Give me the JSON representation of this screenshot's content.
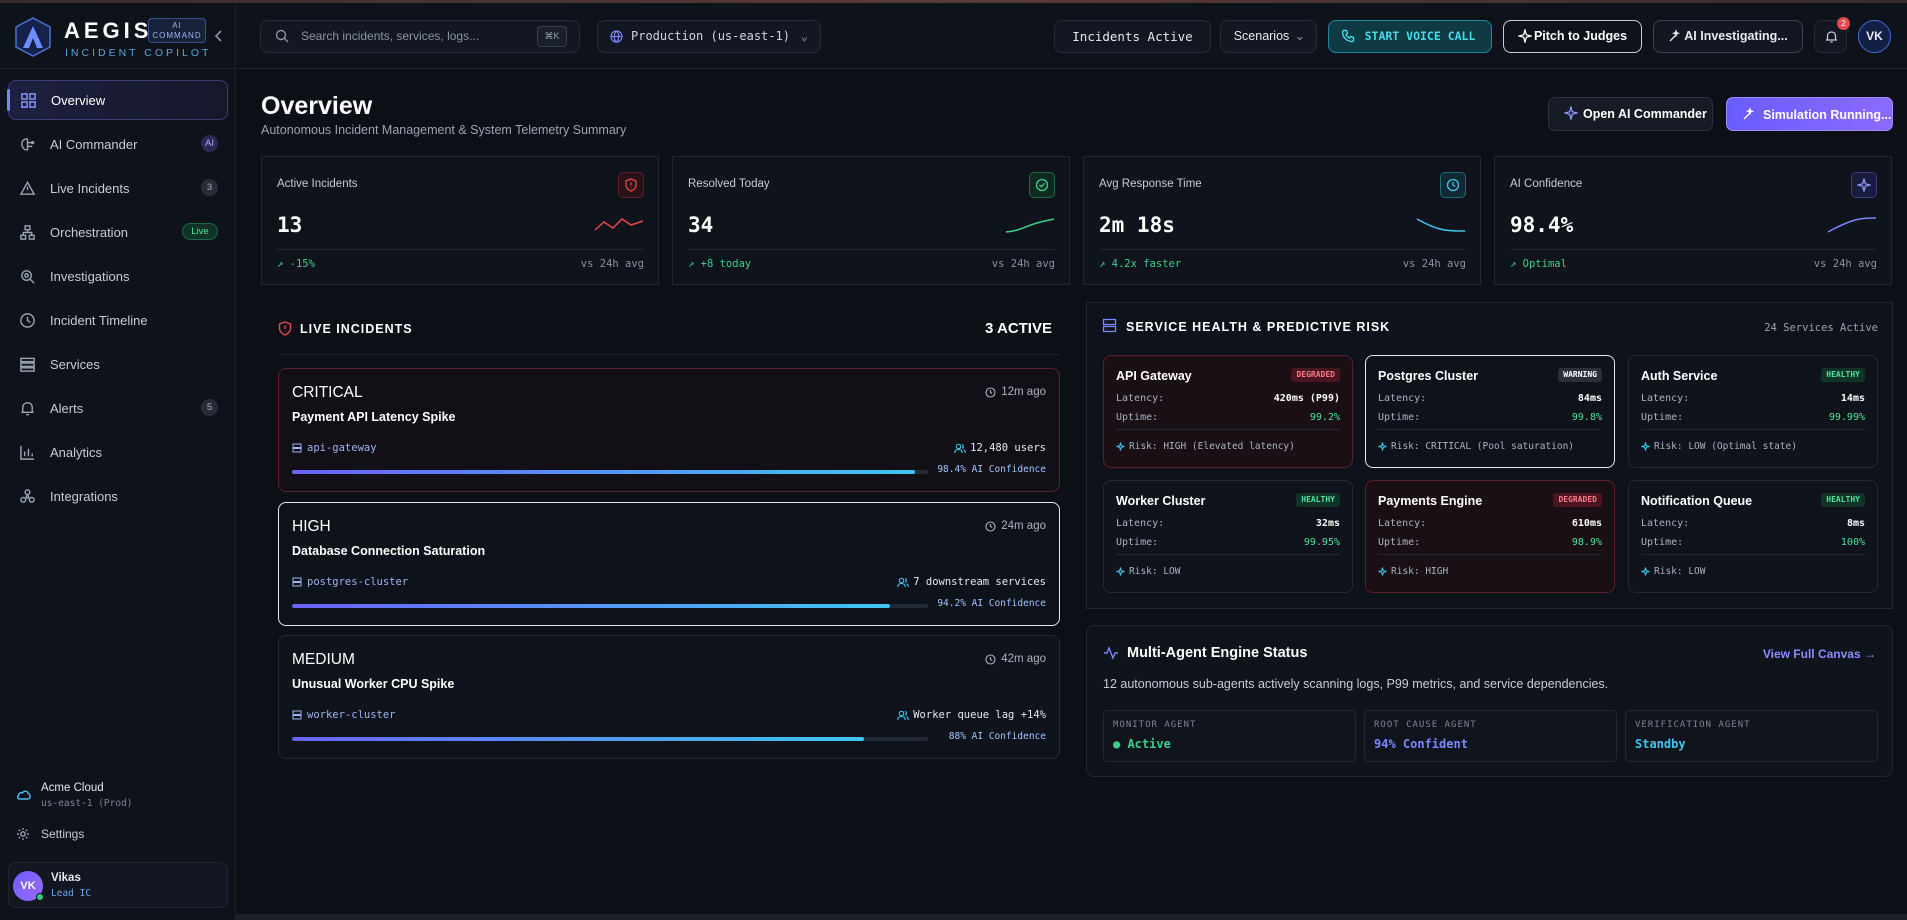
{
  "brand": {
    "name": "AEGIS",
    "badge_line1": "AI",
    "badge_line2": "COMMAND",
    "subtitle": "INCIDENT COPILOT"
  },
  "sidebar": {
    "items": [
      {
        "label": "Overview",
        "icon": "grid-icon",
        "active": true,
        "badge": ""
      },
      {
        "label": "AI Commander",
        "icon": "brain-icon",
        "badge": "AI"
      },
      {
        "label": "Live Incidents",
        "icon": "warning-icon",
        "badge": "3"
      },
      {
        "label": "Orchestration",
        "icon": "network-icon",
        "badge": "Live"
      },
      {
        "label": "Investigations",
        "icon": "search-icon",
        "badge": ""
      },
      {
        "label": "Incident Timeline",
        "icon": "clock-icon",
        "badge": ""
      },
      {
        "label": "Services",
        "icon": "server-icon",
        "badge": ""
      },
      {
        "label": "Alerts",
        "icon": "bell-icon",
        "badge": "5"
      },
      {
        "label": "Analytics",
        "icon": "chart-icon",
        "badge": ""
      },
      {
        "label": "Integrations",
        "icon": "integrations-icon",
        "badge": ""
      }
    ],
    "org": {
      "name": "Acme Cloud",
      "region": "us-east-1 (Prod)"
    },
    "settings": "Settings",
    "user": {
      "initials": "VK",
      "name": "Vikas",
      "role": "Lead IC"
    }
  },
  "topbar": {
    "search_placeholder": "Search incidents, services, logs...",
    "search_kbd": "⌘K",
    "environment": "Production (us-east-1)",
    "incidents_label": "Incidents Active",
    "scenarios_label": "Scenarios",
    "voice_label": "START VOICE CALL",
    "pitch_label": "Pitch to Judges",
    "investigating_label": "AI Investigating...",
    "notifications": "2",
    "avatar": "VK"
  },
  "header": {
    "title": "Overview",
    "subtitle": "Autonomous Incident Management & System Telemetry Summary",
    "open_commander": "Open AI Commander",
    "simulation": "Simulation Running..."
  },
  "kpis": [
    {
      "label": "Active Incidents",
      "value": "13",
      "delta": "-15%",
      "vs": "vs 24h avg",
      "icon": "shield-alert-icon",
      "color": "#e5484d"
    },
    {
      "label": "Resolved Today",
      "value": "34",
      "delta": "+8 today",
      "vs": "vs 24h avg",
      "icon": "check-circle-icon",
      "color": "#3ccf8e"
    },
    {
      "label": "Avg Response Time",
      "value": "2m 18s",
      "delta": "4.2x faster",
      "vs": "vs 24h avg",
      "icon": "clock-icon",
      "color": "#3fc6f0"
    },
    {
      "label": "AI Confidence",
      "value": "98.4%",
      "delta": "Optimal",
      "vs": "vs 24h avg",
      "icon": "sparkle-icon",
      "color": "#7b86ff"
    }
  ],
  "live_incidents": {
    "title": "LIVE INCIDENTS",
    "count": "3 ACTIVE",
    "items": [
      {
        "severity": "CRITICAL",
        "time": "12m ago",
        "title": "Payment API Latency Spike",
        "service": "api-gateway",
        "impact": "12,480 users",
        "confidence": "98.4% AI Confidence",
        "progress": 0.98
      },
      {
        "severity": "HIGH",
        "time": "24m ago",
        "title": "Database Connection Saturation",
        "service": "postgres-cluster",
        "impact": "7 downstream services",
        "confidence": "94.2% AI Confidence",
        "progress": 0.94
      },
      {
        "severity": "MEDIUM",
        "time": "42m ago",
        "title": "Unusual Worker CPU Spike",
        "service": "worker-cluster",
        "impact": "Worker queue lag +14%",
        "confidence": "88% AI Confidence",
        "progress": 0.9
      }
    ]
  },
  "service_health": {
    "title": "SERVICE HEALTH & PREDICTIVE RISK",
    "count": "24 Services Active",
    "latency_label": "Latency:",
    "uptime_label": "Uptime:",
    "services": [
      {
        "name": "API Gateway",
        "status": "DEGRADED",
        "latency": "420ms (P99)",
        "uptime": "99.2%",
        "risk": "Risk: HIGH (Elevated latency)"
      },
      {
        "name": "Postgres Cluster",
        "status": "WARNING",
        "latency": "84ms",
        "uptime": "99.8%",
        "risk": "Risk: CRITICAL (Pool saturation)"
      },
      {
        "name": "Auth Service",
        "status": "HEALTHY",
        "latency": "14ms",
        "uptime": "99.99%",
        "risk": "Risk: LOW (Optimal state)"
      },
      {
        "name": "Worker Cluster",
        "status": "HEALTHY",
        "latency": "32ms",
        "uptime": "99.95%",
        "risk": "Risk: LOW"
      },
      {
        "name": "Payments Engine",
        "status": "DEGRADED",
        "latency": "610ms",
        "uptime": "98.9%",
        "risk": "Risk: HIGH"
      },
      {
        "name": "Notification Queue",
        "status": "HEALTHY",
        "latency": "8ms",
        "uptime": "100%",
        "risk": "Risk: LOW"
      }
    ]
  },
  "engine": {
    "title": "Multi-Agent Engine Status",
    "link": "View Full Canvas",
    "description": "12 autonomous sub-agents actively scanning logs, P99 metrics, and service dependencies.",
    "agents": [
      {
        "label": "MONITOR AGENT",
        "value": "● Active",
        "color": "#3ccf8e"
      },
      {
        "label": "ROOT CAUSE AGENT",
        "value": "94% Confident",
        "color": "#7b86ff"
      },
      {
        "label": "VERIFICATION AGENT",
        "value": "Standby",
        "color": "#3fc6f0"
      }
    ]
  }
}
